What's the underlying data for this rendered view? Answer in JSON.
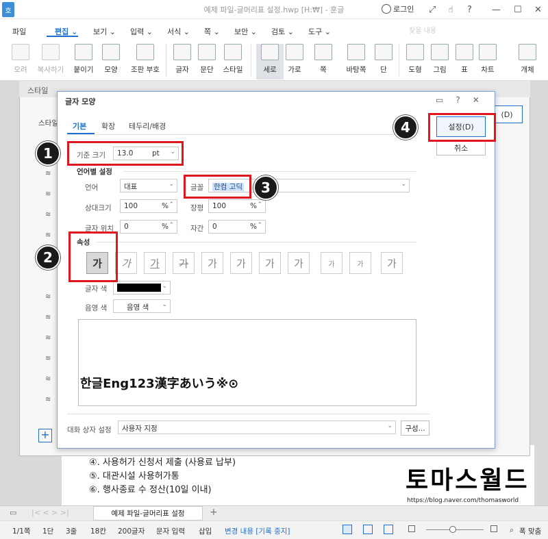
{
  "window": {
    "app_logo": "호",
    "title": "예제 파일-글머리표 설정.hwp [H:₩] - 훈글",
    "login_label": "로그인",
    "controls": [
      "⤢",
      "☝",
      "?",
      "—",
      "☐",
      "✕"
    ]
  },
  "menu": {
    "items": [
      "파일",
      "편집 ⌄",
      "보기 ⌄",
      "입력 ⌄",
      "서식 ⌄",
      "쪽 ⌄",
      "보안 ⌄",
      "검토 ⌄",
      "도구 ⌄"
    ],
    "active_index": 1,
    "search_placeholder": "찾을 내용"
  },
  "toolbar": {
    "tools": [
      {
        "label": "오려",
        "disabled": true
      },
      {
        "label": "복사하기",
        "disabled": true
      },
      {
        "label": "붙이기",
        "disabled": false
      },
      {
        "label": "모양",
        "disabled": false
      },
      {
        "label": "조판 부호",
        "disabled": false
      },
      {
        "label": "글자",
        "disabled": false
      },
      {
        "label": "문단",
        "disabled": false
      },
      {
        "label": "스타일",
        "disabled": false
      },
      {
        "label": "세로",
        "disabled": false,
        "selected": true
      },
      {
        "label": "가로",
        "disabled": false
      },
      {
        "label": "쪽",
        "disabled": false
      },
      {
        "label": "바탕쪽",
        "disabled": false
      },
      {
        "label": "단",
        "disabled": false
      },
      {
        "label": "도형",
        "disabled": false
      },
      {
        "label": "그림",
        "disabled": false
      },
      {
        "label": "표",
        "disabled": false
      },
      {
        "label": "차트",
        "disabled": false
      },
      {
        "label": "개체",
        "disabled": false
      }
    ]
  },
  "style_dialog": {
    "title": "스타일",
    "tab_label": "스타일",
    "side_button": "(D)"
  },
  "char_dialog": {
    "title": "글자 모양",
    "tabs": [
      "기본",
      "확장",
      "테두리/배경"
    ],
    "base_size": {
      "label": "기준 크기",
      "value": "13.0",
      "unit": "pt"
    },
    "lang_section": "언어별 설정",
    "language": {
      "label": "언어",
      "value": "대표"
    },
    "font": {
      "label": "글꼴",
      "value": "한컴 고딕"
    },
    "rel_size": {
      "label": "상대크기",
      "value": "100",
      "unit": "%"
    },
    "char_width": {
      "label": "장평",
      "value": "100",
      "unit": "%"
    },
    "char_pos": {
      "label": "글자 위치",
      "value": "0",
      "unit": "%"
    },
    "char_space": {
      "label": "자간",
      "value": "0",
      "unit": "%"
    },
    "attr_section": "속성",
    "attrs": [
      "가",
      "가",
      "가",
      "가",
      "가",
      "가",
      "가",
      "가",
      "가",
      "가",
      "가"
    ],
    "text_color_label": "글자 색",
    "shade_color_label": "음영 색",
    "shade_color_value": "음영 색",
    "preview": "한글Eng123漢字あいう※⊙",
    "dialog_setting_label": "대화 상자 설정",
    "dialog_setting_value": "사용자 지정",
    "compose_button": "구성...",
    "settings_button": "설정(D)",
    "cancel_button": "취소"
  },
  "document": {
    "lines": [
      "④. 사용허가 신청서 제출 (사용료 납부)",
      "⑤. 대관시설 사용허가통",
      "⑥. 행사종료 수 정산(10일 이내)"
    ]
  },
  "annotations": [
    "1",
    "2",
    "3",
    "4"
  ],
  "watermark": {
    "title": "토마스월드",
    "url": "https://blog.naver.com/thomasworld"
  },
  "bottom": {
    "doc_tab": "예제 파일-글머리표 설정",
    "status": [
      "1/1쪽",
      "1단",
      "3줄",
      "18칸",
      "200글자",
      "문자 입력",
      "삽입",
      "변경 내용 [기록 중지]"
    ],
    "zoom_label": "폭 맞춤"
  },
  "colors": {
    "accent": "#1f6fce",
    "annotation": "#e0161e",
    "text_color": "#000000"
  }
}
